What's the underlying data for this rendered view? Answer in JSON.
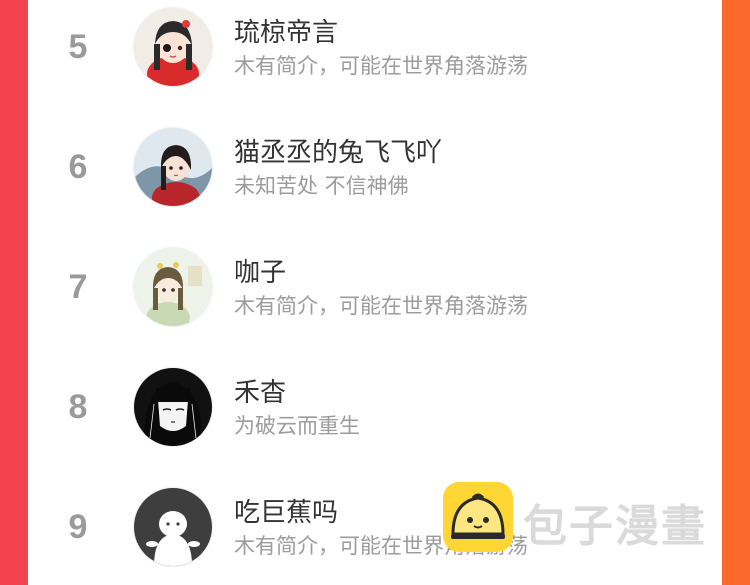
{
  "ranking": {
    "items": [
      {
        "rank": "5",
        "name": "琉椋帝言",
        "bio": "木有简介，可能在世界角落游荡"
      },
      {
        "rank": "6",
        "name": "猫丞丞的兔飞飞吖",
        "bio": "未知苦处 不信神佛"
      },
      {
        "rank": "7",
        "name": "咖子",
        "bio": "木有简介，可能在世界角落游荡"
      },
      {
        "rank": "8",
        "name": "禾杳",
        "bio": "为破云而重生"
      },
      {
        "rank": "9",
        "name": "吃巨蕉吗",
        "bio": "木有简介，可能在世界角落游荡"
      }
    ]
  },
  "watermark": {
    "text": "包子漫畫",
    "logo_icon": "baozi-logo-icon"
  },
  "colors": {
    "background_left": "#f3434f",
    "background_right": "#fb6a2b",
    "panel": "#ffffff",
    "rank": "#9a9a9a",
    "name": "#333333",
    "bio": "#9c9c9c",
    "logo": "#ffd633"
  }
}
